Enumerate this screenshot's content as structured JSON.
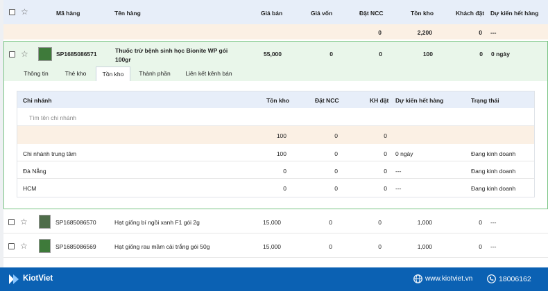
{
  "header": {
    "ma_hang": "Mã hàng",
    "ten_hang": "Tên hàng",
    "gia_ban": "Giá bán",
    "gia_von": "Giá vốn",
    "dat_ncc": "Đặt NCC",
    "ton_kho": "Tồn kho",
    "khach_dat": "Khách đặt",
    "du_kien": "Dự kiến hết hàng"
  },
  "summary": {
    "dat_ncc": "0",
    "ton_kho": "2,200",
    "khach_dat": "0",
    "du_kien": "---"
  },
  "expanded": {
    "code": "SP1685086571",
    "name_line1": "Thuốc trừ bệnh sinh học Bionite WP gói",
    "name_line2": "100gr",
    "gia_ban": "55,000",
    "gia_von": "0",
    "dat_ncc": "0",
    "ton_kho": "100",
    "khach_dat": "0",
    "du_kien": "0 ngày",
    "tabs": [
      "Thông tin",
      "Thẻ kho",
      "Tồn kho",
      "Thành phần",
      "Liên kết kênh bán"
    ],
    "inner": {
      "header": {
        "chi_nhanh": "Chi nhánh",
        "ton_kho": "Tồn kho",
        "dat_ncc": "Đặt NCC",
        "kh_dat": "KH đặt",
        "du_kien": "Dự kiến hết hàng",
        "trang_thai": "Trạng thái"
      },
      "search_placeholder": "Tìm tên chi nhánh",
      "sum": {
        "ton_kho": "100",
        "dat_ncc": "0",
        "kh_dat": "0"
      },
      "rows": [
        {
          "chi_nhanh": "Chi nhánh trung tâm",
          "ton_kho": "100",
          "dat_ncc": "0",
          "kh_dat": "0",
          "du_kien": "0 ngày",
          "trang_thai": "Đang kinh doanh"
        },
        {
          "chi_nhanh": "Đà Nẵng",
          "ton_kho": "0",
          "dat_ncc": "0",
          "kh_dat": "0",
          "du_kien": "---",
          "trang_thai": "Đang kinh doanh"
        },
        {
          "chi_nhanh": "HCM",
          "ton_kho": "0",
          "dat_ncc": "0",
          "kh_dat": "0",
          "du_kien": "---",
          "trang_thai": "Đang kinh doanh"
        }
      ]
    }
  },
  "rows": [
    {
      "code": "SP1685086570",
      "name": "Hạt giống bí ngồi xanh F1 gói 2g",
      "gia_ban": "15,000",
      "gia_von": "0",
      "dat_ncc": "0",
      "ton_kho": "1,000",
      "khach_dat": "0",
      "du_kien": "---"
    },
    {
      "code": "SP1685086569",
      "name": "Hạt giống rau mầm cải trắng gói 50g",
      "gia_ban": "15,000",
      "gia_von": "0",
      "dat_ncc": "0",
      "ton_kho": "1,000",
      "khach_dat": "0",
      "du_kien": "---"
    }
  ],
  "footer": {
    "brand": "KiotViet",
    "website": "www.kiotviet.vn",
    "phone": "18006162"
  }
}
